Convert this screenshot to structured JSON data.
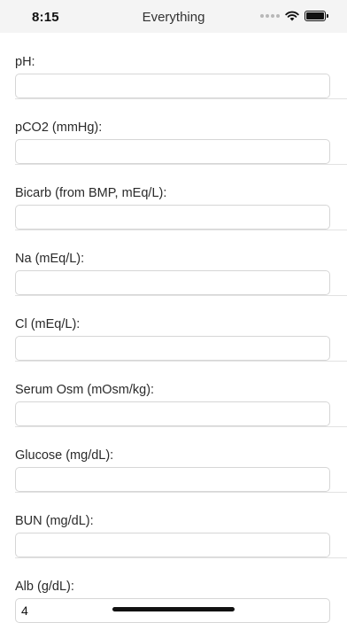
{
  "status_bar": {
    "time": "8:15"
  },
  "nav": {
    "title": "Everything"
  },
  "fields": [
    {
      "label": "pH:",
      "value": ""
    },
    {
      "label": "pCO2 (mmHg):",
      "value": ""
    },
    {
      "label": "Bicarb (from BMP, mEq/L):",
      "value": ""
    },
    {
      "label": "Na (mEq/L):",
      "value": ""
    },
    {
      "label": "Cl (mEq/L):",
      "value": ""
    },
    {
      "label": "Serum Osm (mOsm/kg):",
      "value": ""
    },
    {
      "label": "Glucose (mg/dL):",
      "value": ""
    },
    {
      "label": "BUN (mg/dL):",
      "value": ""
    },
    {
      "label": "Alb (g/dL):",
      "value": "4"
    }
  ],
  "icons": [
    "signal-dots-icon",
    "wifi-icon",
    "battery-icon"
  ]
}
